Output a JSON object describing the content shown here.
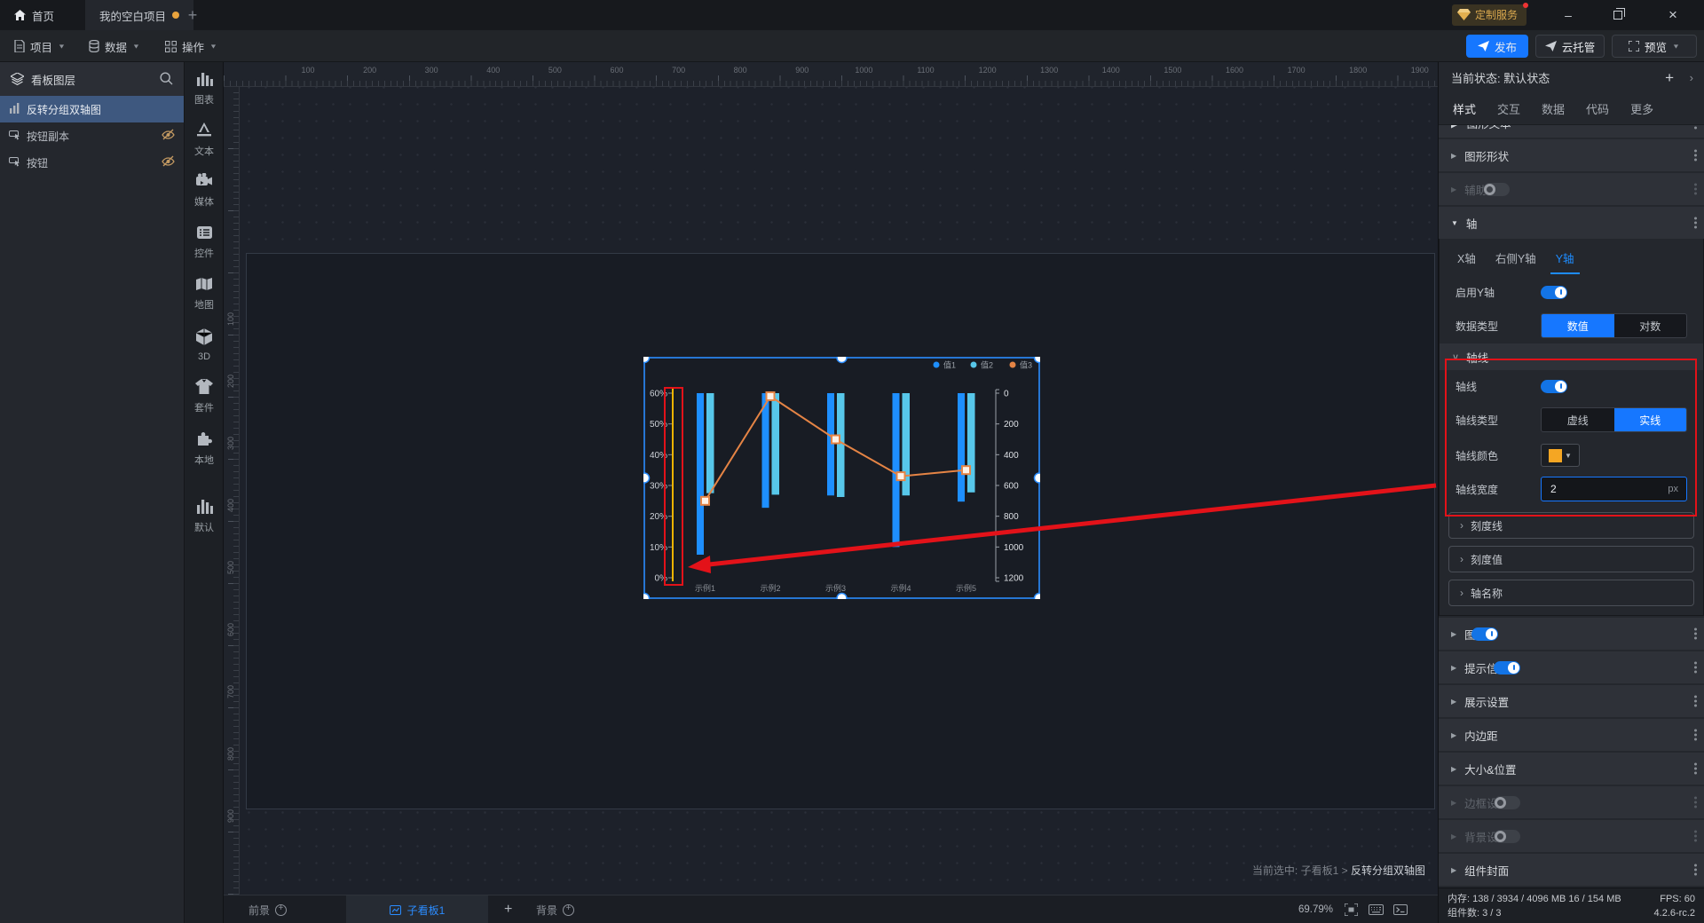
{
  "colors": {
    "accent_blue": "#1677FF",
    "axis_yellow": "#F0B400",
    "annotation_red": "#E31219",
    "bar_blue": "#1E8FFF",
    "bar_cyan": "#57C7EA",
    "line_orange": "#E58445",
    "selection_blue": "#2B8DFF"
  },
  "icons": {
    "home": "home-icon",
    "search": "search-icon",
    "layers": "layers-icon",
    "eye_hidden": "eye-off-icon",
    "kebab": "kebab-menu-icon",
    "diamond": "diamond-icon",
    "chevron_down": "∨",
    "chevron_right": "›",
    "triangle_right": "▶",
    "triangle_down": "▼"
  },
  "titlebar": {
    "home_tab": "首页",
    "project_tab": "我的空白项目",
    "new_tab": "+",
    "badge": "定制服务",
    "minimize": "–",
    "close": "×"
  },
  "menubar": {
    "project": "项目",
    "data": "数据",
    "ops": "操作",
    "publish": "发布",
    "cloud": "云托管",
    "preview": "预览"
  },
  "layers_panel": {
    "title": "看板图层",
    "items": [
      {
        "label": "反转分组双轴图",
        "icon": "dual-axis-chart-icon",
        "selected": true,
        "hidden": false
      },
      {
        "label": "按钮副本",
        "icon": "button-icon",
        "selected": false,
        "hidden": true
      },
      {
        "label": "按钮",
        "icon": "button-icon",
        "selected": false,
        "hidden": true
      }
    ]
  },
  "component_strip": {
    "items": [
      {
        "label": "图表",
        "icon": "chart-icon"
      },
      {
        "label": "文本",
        "icon": "text-icon"
      },
      {
        "label": "媒体",
        "icon": "media-icon"
      },
      {
        "label": "控件",
        "icon": "widget-icon"
      },
      {
        "label": "地图",
        "icon": "map-icon"
      },
      {
        "label": "3D",
        "icon": "cube-3d-icon"
      },
      {
        "label": "套件",
        "icon": "suit-icon"
      },
      {
        "label": "本地",
        "icon": "puzzle-icon"
      },
      {
        "label": "默认",
        "icon": "default-chart-icon",
        "separated": true
      }
    ]
  },
  "canvas": {
    "h_ruler": [
      100,
      200,
      300,
      400,
      500,
      600,
      700,
      800,
      900,
      1000,
      1100,
      1200,
      1300,
      1400,
      1500,
      1600,
      1700,
      1800,
      1900
    ],
    "v_ruler": [
      100,
      200,
      300,
      400,
      500,
      600,
      700,
      800,
      900
    ],
    "status": {
      "label": "当前选中:",
      "board": "子看板1",
      "separator": ">",
      "component": "反转分组双轴图"
    }
  },
  "bottom_bar": {
    "foreground": "前景",
    "board_tab": "子看板1",
    "add": "+",
    "background": "背景",
    "zoom": "69.79%"
  },
  "right_panel": {
    "state": {
      "label": "当前状态: 默认状态",
      "add": "+",
      "collapse": "›"
    },
    "tabs": [
      "样式",
      "交互",
      "数据",
      "代码",
      "更多"
    ],
    "active_tab": "样式",
    "scrolled_section": "图形文本",
    "sections": {
      "shape": "图形形状",
      "aux_line": "辅助线",
      "axis": "轴"
    },
    "axis_panel": {
      "tabs": [
        "X轴",
        "右侧Y轴",
        "Y轴"
      ],
      "active_tab": "Y轴",
      "enable_label": "启用Y轴",
      "data_type_label": "数据类型",
      "data_type_options": [
        "数值",
        "对数"
      ],
      "data_type_selected": "数值",
      "axis_line": {
        "header": "轴线",
        "toggle_label": "轴线",
        "type_label": "轴线类型",
        "type_options": [
          "虚线",
          "实线"
        ],
        "type_selected": "实线",
        "color_label": "轴线颜色",
        "color_value": "#F5A623",
        "width_label": "轴线宽度",
        "width_value": "2",
        "width_unit": "px"
      },
      "collapsed": [
        "刻度线",
        "刻度值",
        "轴名称"
      ]
    },
    "lower_sections": [
      {
        "label": "图例",
        "toggle": "on"
      },
      {
        "label": "提示信息",
        "toggle": "on"
      },
      {
        "label": "展示设置"
      },
      {
        "label": "内边距"
      },
      {
        "label": "大小&位置"
      },
      {
        "label": "边框设置",
        "toggle": "off",
        "disabled": true
      },
      {
        "label": "背景设置",
        "toggle": "off",
        "disabled": true
      },
      {
        "label": "组件封面"
      }
    ],
    "footer": {
      "memory_label": "内存:",
      "memory_value": "138 / 3934 / 4096 MB",
      "memory_extra": "16 / 154 MB",
      "fps_label": "FPS:",
      "fps_value": "60",
      "components_label": "组件数:",
      "components_value": "3 / 3",
      "version": "4.2.6-rc.2"
    }
  },
  "chart_data": {
    "type": "bar",
    "title": "反转分组双轴图",
    "categories": [
      "示例1",
      "示例2",
      "示例3",
      "示例4",
      "示例5"
    ],
    "series": [
      {
        "name": "值1",
        "type": "bar",
        "axis": "right",
        "color": "#1E8FFF",
        "values": [
          1050,
          745,
          665,
          1000,
          705
        ]
      },
      {
        "name": "值2",
        "type": "bar",
        "axis": "right",
        "color": "#57C7EA",
        "values": [
          650,
          660,
          675,
          665,
          645
        ]
      },
      {
        "name": "值3",
        "type": "line",
        "axis": "left",
        "color": "#E58445",
        "values": [
          25,
          59,
          45,
          33,
          35
        ]
      }
    ],
    "left_axis": {
      "unit": "%",
      "ticks": [
        "60%",
        "50%",
        "40%",
        "30%",
        "20%",
        "10%",
        "0%"
      ],
      "min": 0,
      "max": 60,
      "line_color": "#F0B400",
      "inverted": false
    },
    "right_axis": {
      "ticks": [
        "0",
        "200",
        "400",
        "600",
        "800",
        "1000",
        "1200"
      ],
      "min": 0,
      "max": 1200,
      "inverted": true
    },
    "legend": [
      "值1",
      "值2",
      "值3"
    ],
    "legend_position": "top-right",
    "grid": false,
    "bars_hang_from_top": true
  }
}
